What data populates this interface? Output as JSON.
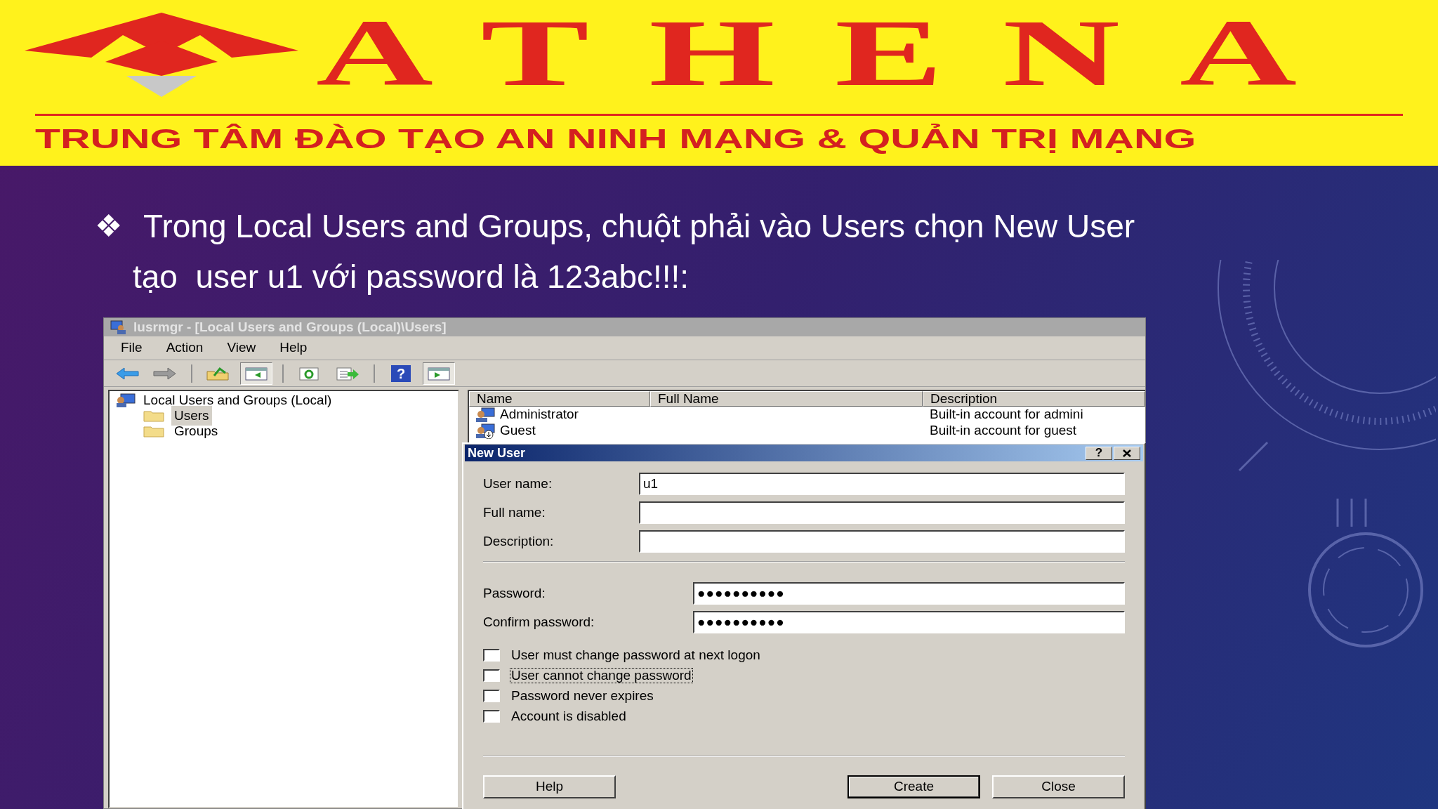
{
  "banner": {
    "logo_text": "ATHENA",
    "tagline": "TRUNG TÂM ĐÀO TẠO AN NINH MẠNG & QUẢN TRỊ MẠNG"
  },
  "bullet": {
    "marker": "❖",
    "text": "Trong Local Users and Groups, chuột phải vào Users chọn New User tạo  user u1 với password là 123abc!!!:"
  },
  "window": {
    "title": "lusrmgr - [Local Users and Groups (Local)\\Users]",
    "menu": [
      "File",
      "Action",
      "View",
      "Help"
    ],
    "toolbar": [
      {
        "kind": "back",
        "pressed": false
      },
      {
        "kind": "forward",
        "pressed": false
      },
      {
        "kind": "separator"
      },
      {
        "kind": "up",
        "pressed": false
      },
      {
        "kind": "tree",
        "pressed": true
      },
      {
        "kind": "separator"
      },
      {
        "kind": "refresh",
        "pressed": false
      },
      {
        "kind": "export",
        "pressed": false
      },
      {
        "kind": "separator"
      },
      {
        "kind": "help",
        "label": "?",
        "pressed": false
      },
      {
        "kind": "action-pane",
        "pressed": true
      }
    ],
    "tree": {
      "label": "Local Users and Groups (Local)",
      "children": [
        {
          "label": "Users",
          "selected": true
        },
        {
          "label": "Groups",
          "selected": false
        }
      ]
    },
    "list": {
      "columns": [
        "Name",
        "Full Name",
        "Description"
      ],
      "rows": [
        {
          "name": "Administrator",
          "kind": "admin",
          "description": "Built-in account for admini"
        },
        {
          "name": "Guest",
          "kind": "guest",
          "description": "Built-in account for guest"
        }
      ]
    }
  },
  "dialog": {
    "title": "New User",
    "help_label": "?",
    "fields": [
      {
        "label": "User name:",
        "value": "u1",
        "kind": "text"
      },
      {
        "label": "Full name:",
        "kind": "text"
      },
      {
        "label": "Description:",
        "kind": "text"
      },
      {
        "label": "Password:",
        "value": "●●●●●●●●●●",
        "kind": "password"
      },
      {
        "label": "Confirm password:",
        "value": "●●●●●●●●●●",
        "kind": "password"
      }
    ],
    "checkboxes": [
      {
        "label": "User must change password at next logon",
        "checked": false,
        "focused": false
      },
      {
        "label": "User cannot change password",
        "checked": false,
        "focused": true
      },
      {
        "label": "Password never expires",
        "checked": false,
        "focused": false
      },
      {
        "label": "Account is disabled",
        "checked": false,
        "focused": false
      }
    ],
    "buttons": [
      {
        "label": "Help",
        "default": false
      },
      {
        "label": "Create",
        "default": true
      },
      {
        "label": "Close",
        "default": false
      }
    ]
  }
}
